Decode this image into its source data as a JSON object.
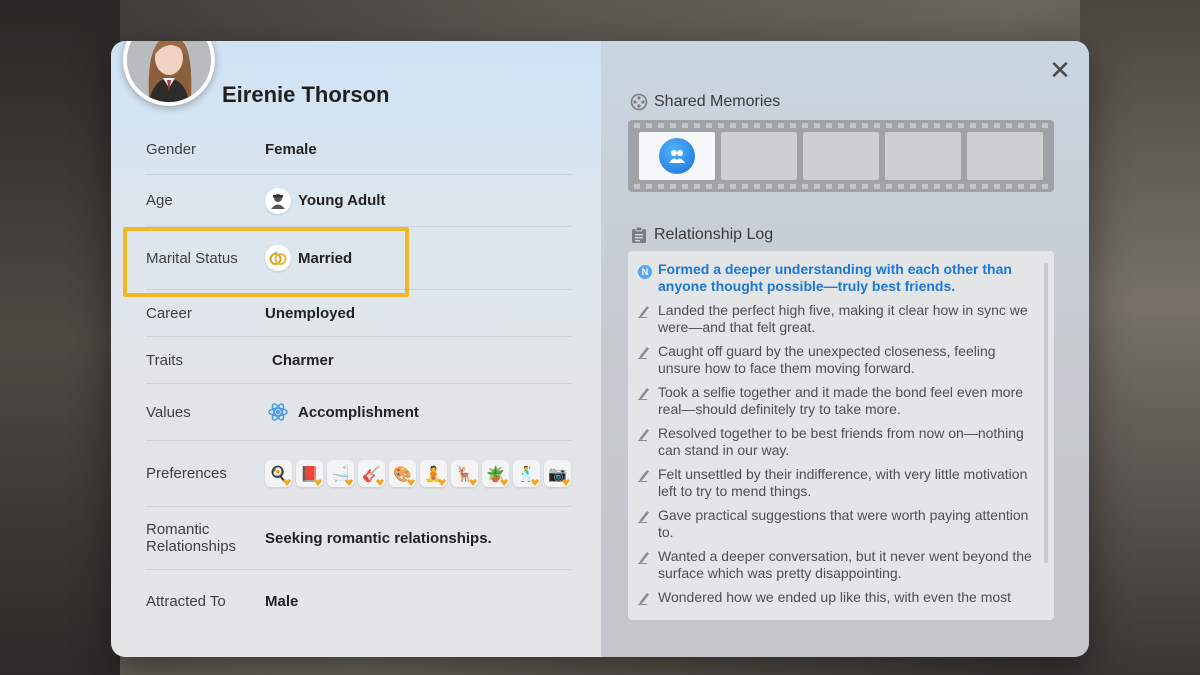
{
  "profile": {
    "name": "Eirenie Thorson",
    "avatar_icon": "portrait"
  },
  "attributes": {
    "gender": {
      "label": "Gender",
      "value": "Female"
    },
    "age": {
      "label": "Age",
      "value": "Young Adult",
      "icon": "young-adult-icon"
    },
    "marital": {
      "label": "Marital Status",
      "value": "Married",
      "icon": "rings-icon"
    },
    "career": {
      "label": "Career",
      "value": "Unemployed"
    },
    "traits": {
      "label": "Traits",
      "value": "Charmer"
    },
    "values": {
      "label": "Values",
      "value": "Accomplishment",
      "icon": "atom-icon"
    },
    "preferences": {
      "label": "Preferences",
      "items": [
        {
          "icon": "cooking-icon",
          "glyph": "🍳"
        },
        {
          "icon": "book-icon",
          "glyph": "📕"
        },
        {
          "icon": "bath-icon",
          "glyph": "🛁"
        },
        {
          "icon": "guitar-icon",
          "glyph": "🎸"
        },
        {
          "icon": "painting-icon",
          "glyph": "🎨"
        },
        {
          "icon": "meditation-icon",
          "glyph": "🧘"
        },
        {
          "icon": "deer-icon",
          "glyph": "🦌"
        },
        {
          "icon": "plant-icon",
          "glyph": "🪴"
        },
        {
          "icon": "dance-icon",
          "glyph": "🕺"
        },
        {
          "icon": "camera-icon",
          "glyph": "📷"
        }
      ]
    },
    "romantic": {
      "label": "Romantic Relationships",
      "value": "Seeking romantic relationships."
    },
    "attracted": {
      "label": "Attracted To",
      "value": "Male"
    }
  },
  "shared_memories": {
    "title": "Shared Memories",
    "frames": 5
  },
  "relationship_log": {
    "title": "Relationship Log",
    "new_badge": "N",
    "entries": [
      {
        "text": "Formed a deeper understanding with each other than anyone thought possible—truly best friends.",
        "new": true
      },
      {
        "text": "Landed the perfect high five, making it clear how in sync we were—and that felt great."
      },
      {
        "text": "Caught off guard by the unexpected closeness, feeling unsure how to face them moving forward."
      },
      {
        "text": "Took a selfie together and it made the bond feel even more real—should definitely try to take more."
      },
      {
        "text": "Resolved together to be best friends from now on—nothing can stand in our way."
      },
      {
        "text": "Felt unsettled by their indifference, with very little motivation left to try to mend things."
      },
      {
        "text": "Gave practical suggestions that were worth paying attention to."
      },
      {
        "text": "Wanted a deeper conversation, but it never went beyond the surface which was pretty disappointing."
      },
      {
        "text": "Wondered how we ended up like this, with even the most"
      }
    ]
  },
  "close_label": "✕"
}
